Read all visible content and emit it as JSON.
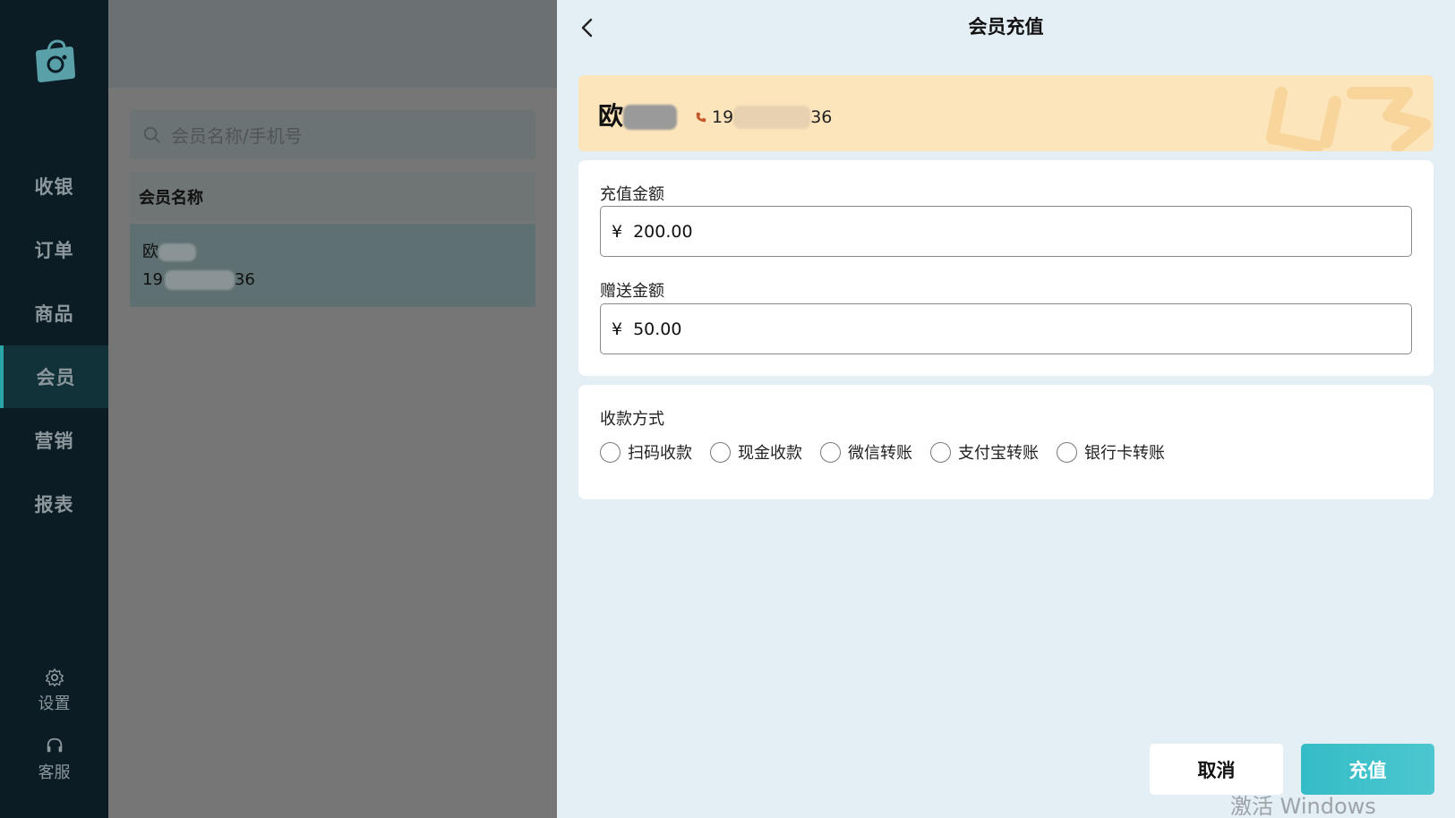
{
  "nav": {
    "items": [
      {
        "label": "收银"
      },
      {
        "label": "订单"
      },
      {
        "label": "商品"
      },
      {
        "label": "会员",
        "active": true
      },
      {
        "label": "营销"
      },
      {
        "label": "报表"
      }
    ],
    "settings_label": "设置",
    "support_label": "客服"
  },
  "member_list": {
    "search_placeholder": "会员名称/手机号",
    "column_header": "会员名称",
    "rows": [
      {
        "name_visible": "欧",
        "phone_prefix": "19",
        "phone_suffix": "36"
      }
    ]
  },
  "recharge": {
    "title": "会员充值",
    "member": {
      "name_visible": "欧",
      "phone_prefix": "19",
      "phone_suffix": "36"
    },
    "amount_label": "充值金额",
    "amount_currency": "¥",
    "amount_value": "200.00",
    "bonus_label": "赠送金额",
    "bonus_currency": "¥",
    "bonus_value": "50.00",
    "payment_label": "收款方式",
    "payment_methods": [
      "扫码收款",
      "现金收款",
      "微信转账",
      "支付宝转账",
      "银行卡转账"
    ],
    "cancel_label": "取消",
    "submit_label": "充值"
  },
  "watermark": "激活 Windows",
  "colors": {
    "nav_bg": "#0b1c24",
    "accent": "#34bcc6",
    "member_card_bg": "#fce4bb",
    "panel_bg": "#e3eef5"
  }
}
